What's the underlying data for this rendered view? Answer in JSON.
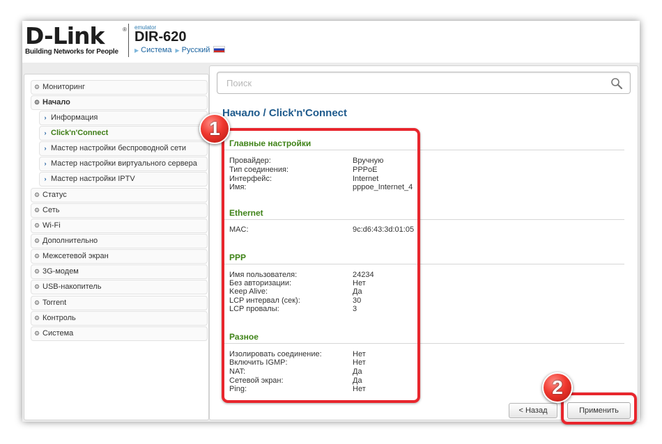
{
  "header": {
    "brand": "D-Link",
    "brand_reg": "®",
    "tagline": "Building Networks for People",
    "emulator_label": "emulator",
    "model": "DIR-620",
    "crumbs": [
      "Система",
      "Русский"
    ]
  },
  "sidebar": {
    "items": [
      {
        "label": "Мониторинг"
      },
      {
        "label": "Начало"
      },
      {
        "label": "Информация"
      },
      {
        "label": "Click'n'Connect"
      },
      {
        "label": "Мастер настройки беспроводной сети"
      },
      {
        "label": "Мастер настройки виртуального сервера"
      },
      {
        "label": "Мастер настройки IPTV"
      },
      {
        "label": "Статус"
      },
      {
        "label": "Сеть"
      },
      {
        "label": "Wi-Fi"
      },
      {
        "label": "Дополнительно"
      },
      {
        "label": "Межсетевой экран"
      },
      {
        "label": "3G-модем"
      },
      {
        "label": "USB-накопитель"
      },
      {
        "label": "Torrent"
      },
      {
        "label": "Контроль"
      },
      {
        "label": "Система"
      }
    ]
  },
  "search": {
    "placeholder": "Поиск"
  },
  "page_title": "Начало /  Click'n'Connect",
  "sections": {
    "main": {
      "title": "Главные настройки",
      "rows": [
        {
          "label": "Провайдер:",
          "value": "Вручную"
        },
        {
          "label": "Тип соединения:",
          "value": "PPPoE"
        },
        {
          "label": "Интерфейс:",
          "value": "Internet"
        },
        {
          "label": "Имя:",
          "value": "pppoe_Internet_4"
        }
      ]
    },
    "ethernet": {
      "title": "Ethernet",
      "rows": [
        {
          "label": "MAC:",
          "value": "9c:d6:43:3d:01:05"
        }
      ]
    },
    "ppp": {
      "title": "PPP",
      "rows": [
        {
          "label": "Имя пользователя:",
          "value": "24234"
        },
        {
          "label": "Без авторизации:",
          "value": "Нет"
        },
        {
          "label": "Keep Alive:",
          "value": "Да"
        },
        {
          "label": "LCP интервал (сек):",
          "value": "30"
        },
        {
          "label": "LCP провалы:",
          "value": "3"
        }
      ]
    },
    "misc": {
      "title": "Разное",
      "rows": [
        {
          "label": "Изолировать соединение:",
          "value": "Нет"
        },
        {
          "label": "Включить IGMP:",
          "value": "Нет"
        },
        {
          "label": "NAT:",
          "value": "Да"
        },
        {
          "label": "Сетевой экран:",
          "value": "Да"
        },
        {
          "label": "Ping:",
          "value": "Нет"
        }
      ]
    }
  },
  "buttons": {
    "back": "< Назад",
    "apply": "Применить"
  },
  "annotations": {
    "badge1": "1",
    "badge2": "2",
    "color": "#e8262d"
  }
}
